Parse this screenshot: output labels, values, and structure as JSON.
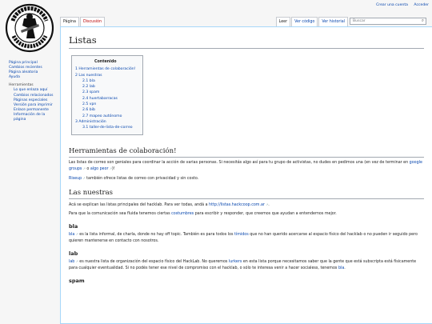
{
  "personal": {
    "create_account": "Crear una cuenta",
    "login": "Acceder"
  },
  "tabs_left": {
    "page": "Página",
    "discussion": "Discusión"
  },
  "tabs_right": {
    "read": "Leer",
    "view_source": "Ver código",
    "history": "Ver historial"
  },
  "search": {
    "placeholder": "Buscar",
    "icon": "search-icon"
  },
  "sidebar": {
    "nav": [
      "Página principal",
      "Cambios recientes",
      "Página aleatoria",
      "Ayuda"
    ],
    "tools_heading": "Herramientas",
    "tools": [
      "Lo que enlaza aquí",
      "Cambios relacionados",
      "Páginas especiales",
      "Versión para imprimir",
      "Enlace permanente",
      "Información de la",
      "página"
    ]
  },
  "page": {
    "title": "Listas"
  },
  "toc": {
    "title": "Contenido",
    "items": [
      {
        "text": "1 Herramientas de colaboración!",
        "level": 1
      },
      {
        "text": "2 Las nuestras",
        "level": 1
      },
      {
        "text": "2.1 bla",
        "level": 2
      },
      {
        "text": "2.2 lab",
        "level": 2
      },
      {
        "text": "2.3 spam",
        "level": 2
      },
      {
        "text": "2.4 huertabarracas",
        "level": 2
      },
      {
        "text": "2.5 vpn",
        "level": 2
      },
      {
        "text": "2.6 bib",
        "level": 2
      },
      {
        "text": "2.7 mapeo autónomo",
        "level": 2
      },
      {
        "text": "3 Administración",
        "level": 1
      },
      {
        "text": "3.1 taller-de-lista-de-correo",
        "level": 2
      }
    ]
  },
  "s1": {
    "heading": "Herramientas de colaboración!",
    "p1_a": "Las listas de correo son geniales para coordinar la acción de varias personas. Si necesitás algo así para tu grupo de activistas, no dudes en pedimos una (en vez de terminar en ",
    "p1_link1": "google groups",
    "p1_b": " o ",
    "p1_link2": "algo peor",
    "p1_c": ")!",
    "p2_link": "Riseup",
    "p2_text": " también ofrece listas de correo con privacidad y sin costo."
  },
  "s2": {
    "heading": "Las nuestras",
    "p1_text": "Acá se explican las listas principales del hacklab. Para ver todas, andá a ",
    "p1_link": "http://listas.hackcoop.com.ar",
    "p1_end": ".",
    "p2_a": "Para que la comunicación sea fluida tenemos ciertas ",
    "p2_link": "costumbres",
    "p2_b": " para escribir y responder, que creemos que ayudan a entendernos mejor."
  },
  "bla": {
    "heading": "bla",
    "link": "bla",
    "text_a": " es la lista informal, de charla, donde no hay off topic. También es para todos los ",
    "link2": "tímidos",
    "text_b": " que no han querido acercarse al espacio físico del hacklab o no pueden ir seguido pero quieren mantenerse en contacto con nosotros."
  },
  "lab": {
    "heading": "lab",
    "link": "lab",
    "text_a": " es nuestra lista de organización del espacio físico del HackLab. No queremos ",
    "link2": "lurkers",
    "text_b": " en esta lista porque necesitamos saber que la gente que está subscripta está físicamente para cualquier eventualidad. Si no podés tener ese nivel de compromiso con el hacklab, o sólo te interesa venir a hacer socialess, tenemos ",
    "link3": "bla",
    "text_c": "."
  },
  "spam": {
    "heading": "spam"
  },
  "colors": {
    "link": "#0645ad",
    "redlink": "#ba0000",
    "content_border": "#a7d7f9"
  }
}
